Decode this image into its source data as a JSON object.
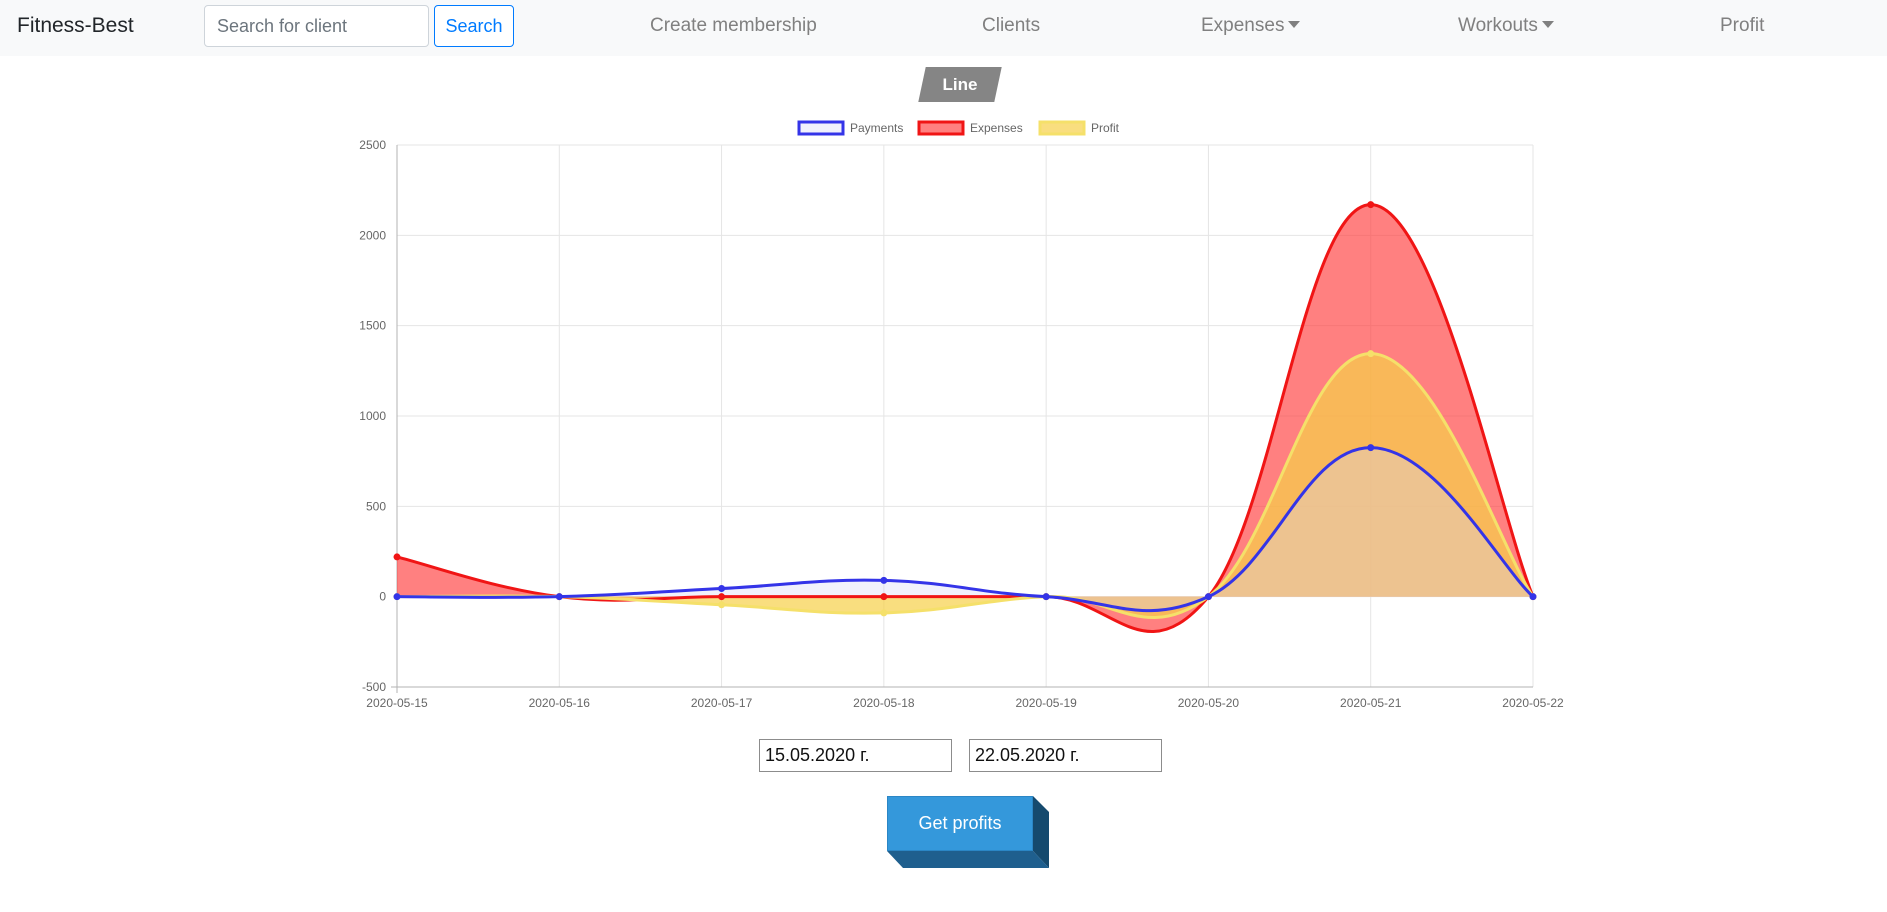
{
  "navbar": {
    "brand": "Fitness-Best",
    "search_placeholder": "Search for client",
    "search_label": "Search",
    "links": {
      "create_membership": "Create membership",
      "clients": "Clients",
      "expenses": "Expenses",
      "workouts": "Workouts",
      "profit": "Profit"
    }
  },
  "chart_type_label": "Line",
  "chart_data": {
    "type": "area",
    "categories": [
      "2020-05-15",
      "2020-05-16",
      "2020-05-17",
      "2020-05-18",
      "2020-05-19",
      "2020-05-20",
      "2020-05-21",
      "2020-05-22"
    ],
    "series": [
      {
        "name": "Payments",
        "values": [
          0,
          0,
          45,
          90,
          0,
          0,
          825,
          0
        ],
        "color": "#3434e8",
        "fill": "rgba(215,215,245,0.35)"
      },
      {
        "name": "Expenses",
        "values": [
          220,
          0,
          0,
          0,
          0,
          0,
          2170,
          0
        ],
        "color": "#f01515",
        "fill": "rgba(255,60,60,0.65)"
      },
      {
        "name": "Profit",
        "values": [
          0,
          0,
          -45,
          -90,
          0,
          0,
          1345,
          0
        ],
        "color": "#f5e06a",
        "fill": "rgba(246,208,72,0.7)"
      }
    ],
    "yticks": [
      2500,
      2000,
      1500,
      1000,
      500,
      0,
      -500
    ],
    "ylim": [
      -500,
      2500
    ],
    "grid": true,
    "legend": "top-center"
  },
  "date_range": {
    "from": "15.05.2020 г.",
    "to": "22.05.2020 г."
  },
  "get_profits_label": "Get profits"
}
